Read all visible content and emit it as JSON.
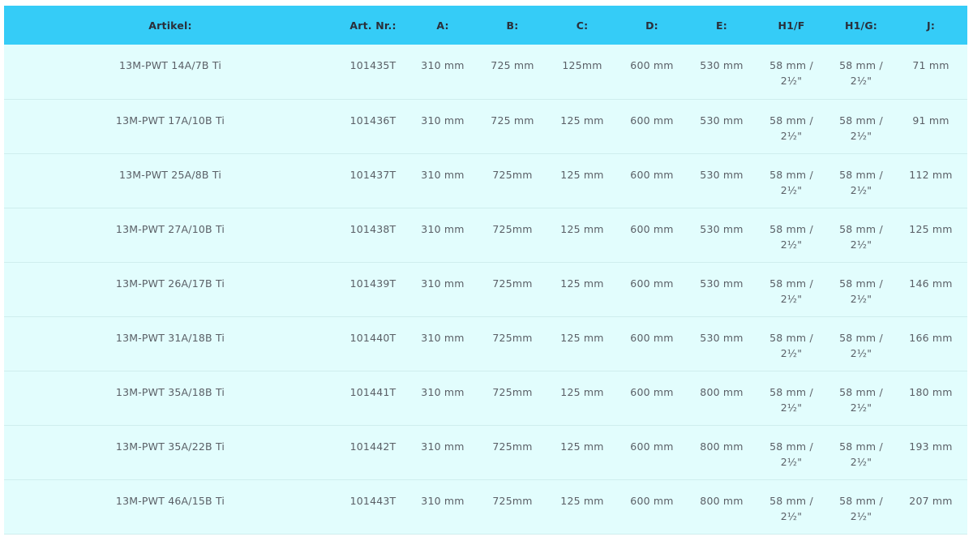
{
  "table": {
    "headers": [
      "Artikel:",
      "Art. Nr.:",
      "A:",
      "B:",
      "C:",
      "D:",
      "E:",
      "H1/F",
      "H1/G:",
      "J:"
    ],
    "rows": [
      {
        "artikel": "13M-PWT 14A/7B Ti",
        "art_nr": "101435T",
        "a": "310 mm",
        "b": "725 mm",
        "c": "125mm",
        "d": "600 mm",
        "e": "530 mm",
        "h1f_1": "58 mm /",
        "h1f_2": "2½\"",
        "h1g_1": "58 mm /",
        "h1g_2": "2½\"",
        "j": "71 mm"
      },
      {
        "artikel": "13M-PWT 17A/10B Ti",
        "art_nr": "101436T",
        "a": "310 mm",
        "b": "725 mm",
        "c": "125 mm",
        "d": "600 mm",
        "e": "530 mm",
        "h1f_1": "58 mm /",
        "h1f_2": "2½\"",
        "h1g_1": "58 mm /",
        "h1g_2": "2½\"",
        "j": "91 mm"
      },
      {
        "artikel": "13M-PWT 25A/8B Ti",
        "art_nr": "101437T",
        "a": "310 mm",
        "b": "725mm",
        "c": "125 mm",
        "d": "600 mm",
        "e": "530 mm",
        "h1f_1": "58 mm /",
        "h1f_2": "2½\"",
        "h1g_1": "58 mm /",
        "h1g_2": "2½\"",
        "j": "112 mm"
      },
      {
        "artikel": "13M-PWT 27A/10B Ti",
        "art_nr": "101438T",
        "a": "310 mm",
        "b": "725mm",
        "c": "125 mm",
        "d": "600 mm",
        "e": "530 mm",
        "h1f_1": "58 mm /",
        "h1f_2": "2½\"",
        "h1g_1": "58 mm /",
        "h1g_2": "2½\"",
        "j": "125 mm"
      },
      {
        "artikel": "13M-PWT 26A/17B Ti",
        "art_nr": "101439T",
        "a": "310 mm",
        "b": "725mm",
        "c": "125 mm",
        "d": "600 mm",
        "e": "530 mm",
        "h1f_1": "58 mm /",
        "h1f_2": "2½\"",
        "h1g_1": "58 mm /",
        "h1g_2": "2½\"",
        "j": "146 mm"
      },
      {
        "artikel": "13M-PWT 31A/18B Ti",
        "art_nr": "101440T",
        "a": "310 mm",
        "b": "725mm",
        "c": "125 mm",
        "d": "600 mm",
        "e": "530 mm",
        "h1f_1": "58 mm /",
        "h1f_2": "2½\"",
        "h1g_1": "58 mm /",
        "h1g_2": "2½\"",
        "j": "166 mm"
      },
      {
        "artikel": "13M-PWT 35A/18B Ti",
        "art_nr": "101441T",
        "a": "310 mm",
        "b": "725mm",
        "c": "125 mm",
        "d": "600 mm",
        "e": "800 mm",
        "h1f_1": "58 mm /",
        "h1f_2": "2½\"",
        "h1g_1": "58 mm /",
        "h1g_2": "2½\"",
        "j": "180 mm"
      },
      {
        "artikel": "13M-PWT 35A/22B Ti",
        "art_nr": "101442T",
        "a": "310 mm",
        "b": "725mm",
        "c": "125 mm",
        "d": "600 mm",
        "e": "800 mm",
        "h1f_1": "58 mm /",
        "h1f_2": "2½\"",
        "h1g_1": "58 mm /",
        "h1g_2": "2½\"",
        "j": "193 mm"
      },
      {
        "artikel": "13M-PWT 46A/15B Ti",
        "art_nr": "101443T",
        "a": "310 mm",
        "b": "725mm",
        "c": "125 mm",
        "d": "600 mm",
        "e": "800 mm",
        "h1f_1": "58 mm /",
        "h1f_2": "2½\"",
        "h1g_1": "58 mm /",
        "h1g_2": "2½\"",
        "j": "207 mm"
      }
    ]
  },
  "colors": {
    "header_bg": "#35ccf7",
    "row_bg": "#e2fdfd",
    "row_border": "#cfeeee",
    "header_text": "#2a2f3a",
    "cell_text": "#5a5f66"
  }
}
